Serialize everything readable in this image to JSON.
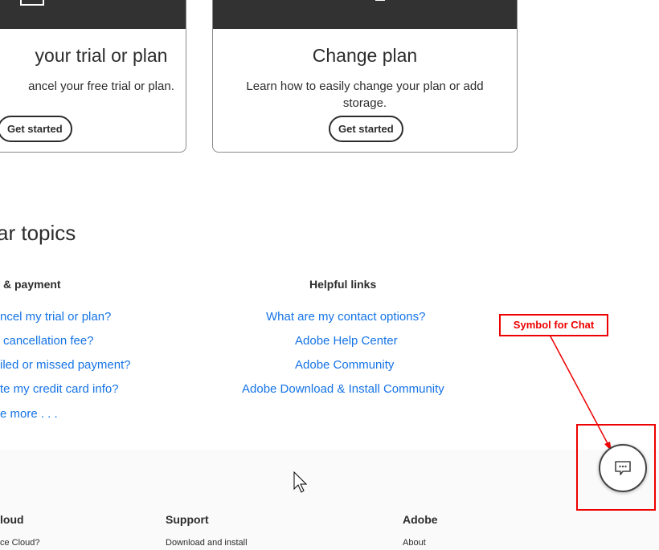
{
  "cards": [
    {
      "title": "your trial or plan",
      "desc": "ancel your free trial or plan.",
      "button": "Get started"
    },
    {
      "title": "Change plan",
      "desc": "Learn how to easily change your plan or add storage.",
      "button": "Get started"
    }
  ],
  "topics": {
    "title": "ar topics",
    "col1": {
      "heading": "& payment",
      "links": [
        "ncel my trial or plan?",
        "cancellation fee?",
        "iled or missed payment?",
        "te my credit card info?",
        "e more . . ."
      ]
    },
    "col2": {
      "heading": "Helpful links",
      "links": [
        "What are my contact options?",
        "Adobe Help Center",
        "Adobe Community",
        "Adobe Download & Install Community"
      ]
    }
  },
  "footer": {
    "cols": [
      {
        "heading": "loud",
        "link": "ce Cloud?"
      },
      {
        "heading": "Support",
        "link": "Download and install"
      },
      {
        "heading": "Adobe",
        "link": "About"
      }
    ]
  },
  "annotation": {
    "label": "Symbol for Chat",
    "color": "#ee0000"
  },
  "chat": {
    "icon": "chat-bubble-icon"
  },
  "colors": {
    "link": "#1473e6",
    "band": "#323232",
    "footer": "#fafafa"
  }
}
